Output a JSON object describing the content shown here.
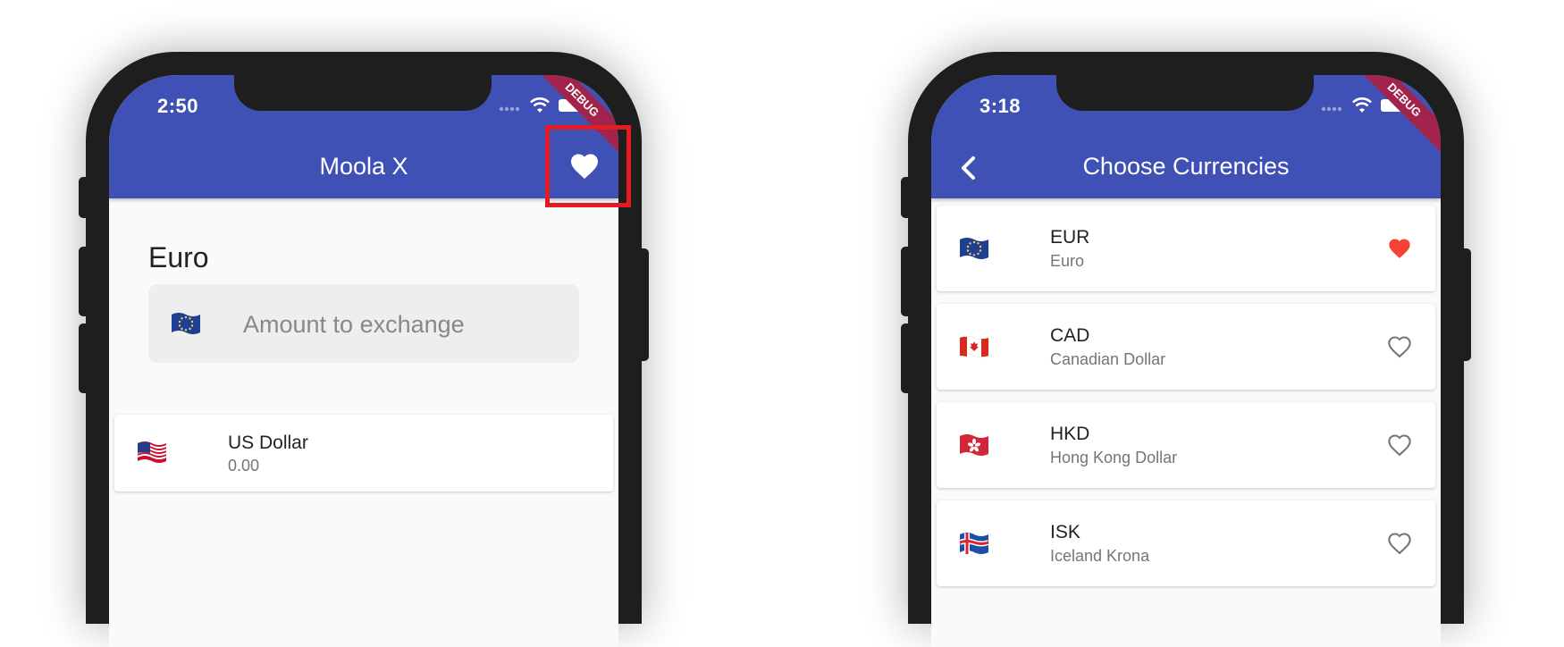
{
  "left_screen": {
    "status_time": "2:50",
    "debug_label": "DEBUG",
    "app_title": "Moola X",
    "base_currency_label": "Euro",
    "amount_placeholder": "Amount to exchange",
    "conversions": [
      {
        "flag": "us-flag-icon",
        "name": "US Dollar",
        "value": "0.00"
      }
    ]
  },
  "right_screen": {
    "status_time": "3:18",
    "debug_label": "DEBUG",
    "app_title": "Choose Currencies",
    "currencies": [
      {
        "flag": "eu-flag-icon",
        "code": "EUR",
        "name": "Euro",
        "favorite": true
      },
      {
        "flag": "ca-flag-icon",
        "code": "CAD",
        "name": "Canadian Dollar",
        "favorite": false
      },
      {
        "flag": "hk-flag-icon",
        "code": "HKD",
        "name": "Hong Kong Dollar",
        "favorite": false
      },
      {
        "flag": "is-flag-icon",
        "code": "ISK",
        "name": "Iceland Krona",
        "favorite": false
      }
    ]
  },
  "colors": {
    "app_bar": "#3f51b5",
    "highlight": "#e31c23",
    "favorite_active": "#f44336",
    "favorite_inactive": "#757575",
    "debug_ribbon": "#a1244d"
  }
}
